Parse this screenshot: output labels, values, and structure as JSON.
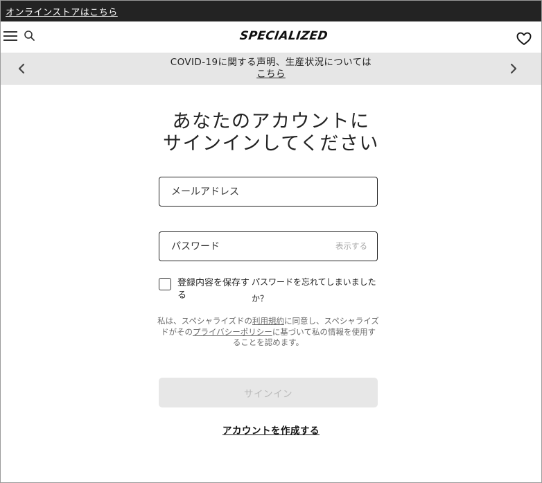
{
  "promo": {
    "label": "オンラインストアはこちら"
  },
  "header": {
    "logo": "SPECIALIZED",
    "menu_icon": "hamburger-menu-icon",
    "search_icon": "search-icon",
    "wishlist_icon": "heart-icon"
  },
  "announcement": {
    "text": "COVID-19に関する声明、生産状況については",
    "link_label": "こちら"
  },
  "login": {
    "title_line1": "あなたのアカウントに",
    "title_line2": "サインインしてください",
    "email_placeholder": "メールアドレス",
    "password_placeholder": "パスワード",
    "show_password": "表示する",
    "remember_me": "登録内容を保存する",
    "forgot_password": "パスワードを忘れてしまいましたか？",
    "legal_part1": "私は、スペシャライズドの",
    "terms_link": "利用規約",
    "legal_part2": "に同意し、スペシャライズドがその",
    "privacy_link": "プライバシーポリシー",
    "legal_part3": "に基づいて私の情報を使用することを認めます。",
    "signin_button": "サインイン",
    "create_account": "アカウントを作成する"
  },
  "colors": {
    "promo_bg": "#232323",
    "announce_bg": "#e6e6e6",
    "button_disabled_bg": "#e7e7e7",
    "button_disabled_text": "#b8b8b8",
    "muted_text": "#6b6b6b"
  }
}
